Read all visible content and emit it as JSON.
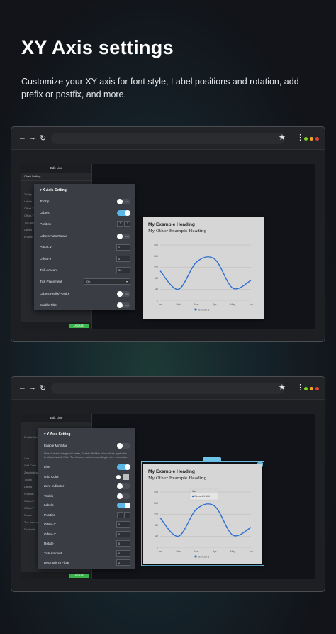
{
  "hero": {
    "title": "XY Axis settings",
    "subtitle": "Customize your XY axis for font style, Label positions and rotation, add prefix or postfix, and more."
  },
  "browser": {
    "back_icon": "←",
    "forward_icon": "→",
    "reload_icon": "↻",
    "star_icon": "★",
    "menu_icon": "⋮",
    "dot_colors": [
      "#f5a623",
      "#7ed321",
      "#e0443a"
    ]
  },
  "editor": {
    "title": "Edit Line",
    "section": "Chart Setting",
    "rows1": [
      "Tooltip",
      "Labels",
      "Offset-X",
      "Offset-Y",
      "Tick Amount",
      "Labels",
      "Enable"
    ],
    "rows2": [
      "Enable Min/Max",
      "Line",
      "Grid Color",
      "Zero Indicator",
      "Tooltip",
      "Labels",
      "Position",
      "Offset-X",
      "Offset-Y",
      "Rotate",
      "Tick Amount",
      "Decimals",
      "Label"
    ],
    "update": "UPDATE"
  },
  "xaxis": {
    "title": "X-Axis Setting",
    "tooltip": "Tooltip",
    "labels": "Labels",
    "position": "Position",
    "auto_rotate": "Labels Auto Rotate",
    "offset_x": "Offset-X",
    "offset_x_val": "0",
    "offset_y": "Offset-Y",
    "offset_y_val": "0",
    "tick_amount": "Tick Amount",
    "tick_amount_val": "30",
    "tick_placement": "Tick Placement",
    "tick_placement_val": "On",
    "prefix_postfix": "Labels Prefix/Postfix",
    "enable_title": "Enable Title",
    "toggle_off": "Hide",
    "toggle_on": "Show"
  },
  "yaxis": {
    "title": "Y-Axis Setting",
    "enable_minmax": "Enable Min/Max",
    "note": "Note: If chart having multi series, Enable Min/Max value will be applicable to all series and Y-Axis Tick Amount must be according to min - max value.",
    "line": "Line",
    "grid_color": "Grid Color",
    "zero_indicator": "Zero Indicator",
    "tooltip": "Tooltip",
    "labels": "Labels",
    "position": "Position",
    "offset_x": "Offset-X",
    "offset_x_val": "0",
    "offset_y": "Offset-Y",
    "offset_y_val": "0",
    "rotate": "Rotate",
    "rotate_val": "0",
    "tick_amount": "Tick Amount",
    "tick_amount_val": "0",
    "decimals": "Decimals In Float",
    "decimals_val": "2"
  },
  "chart": {
    "heading": "My Example Heading",
    "subheading": "My Other Example Heading",
    "tooltip_date": "Jan",
    "tooltip_value": "Element 1: 106"
  },
  "chart_data": {
    "type": "line",
    "categories": [
      "Jan",
      "Feb",
      "Mar",
      "Apr",
      "May",
      "Jun"
    ],
    "series": [
      {
        "name": "Element 1",
        "values": [
          106,
          40,
          138,
          149,
          44,
          72
        ]
      }
    ],
    "ylim": [
      0,
      200
    ],
    "yticks": [
      "0",
      "40",
      "80",
      "120",
      "160",
      "200"
    ],
    "color": "#2f6fcf",
    "grid": true,
    "legend": "bottom"
  }
}
